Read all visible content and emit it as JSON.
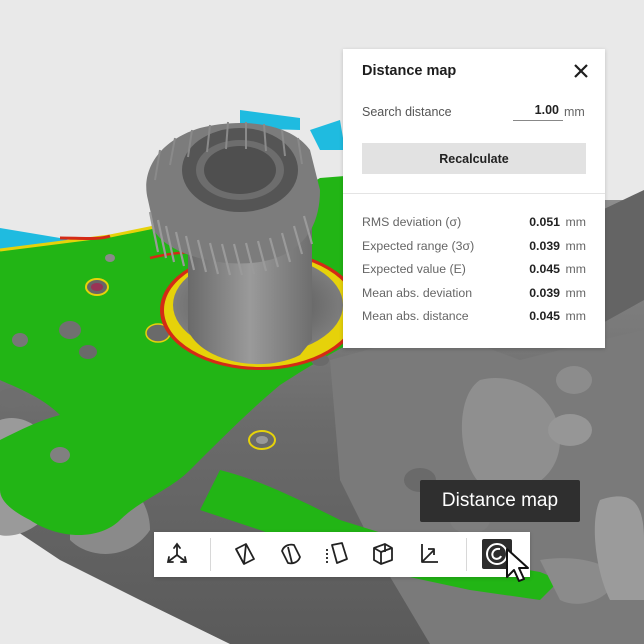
{
  "panel": {
    "title": "Distance map",
    "search_distance_label": "Search distance",
    "search_distance_value": "1.00",
    "search_distance_unit": "mm",
    "recalculate_label": "Recalculate",
    "stats": [
      {
        "label": "RMS deviation (σ)",
        "value": "0.051",
        "unit": "mm"
      },
      {
        "label": "Expected range (3σ)",
        "value": "0.039",
        "unit": "mm"
      },
      {
        "label": "Expected value (E)",
        "value": "0.045",
        "unit": "mm"
      },
      {
        "label": "Mean abs. deviation",
        "value": "0.039",
        "unit": "mm"
      },
      {
        "label": "Mean abs. distance",
        "value": "0.045",
        "unit": "mm"
      }
    ]
  },
  "tooltip": {
    "text": "Distance map"
  },
  "toolbar": {
    "tools": [
      {
        "icon": "axes-icon"
      },
      {
        "icon": "box-view-icon"
      },
      {
        "icon": "rounded-box-view-icon"
      },
      {
        "icon": "dotted-box-view-icon"
      },
      {
        "icon": "grid-box-view-icon"
      },
      {
        "icon": "clip-box-view-icon"
      },
      {
        "icon": "distance-map-icon",
        "active": true
      }
    ]
  },
  "colors": {
    "panel_bg": "#ffffff",
    "tooltip_bg": "#2f2f2f",
    "active_tool_bg": "#2c2c2c",
    "deviation_green": "#22b515",
    "deviation_yellow": "#e6d20a",
    "deviation_red": "#d42a16",
    "deviation_cyan": "#1fbbe0"
  }
}
